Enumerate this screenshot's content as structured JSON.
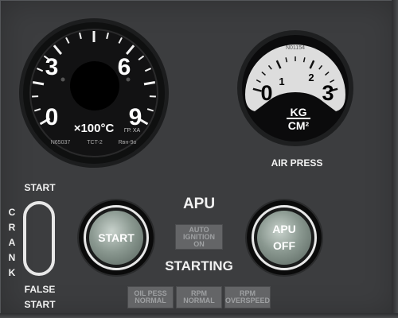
{
  "egt_gauge": {
    "scale": [
      "0",
      "3",
      "6",
      "9"
    ],
    "unit": "×100°C",
    "serial": "N65037",
    "model": "TCT-2",
    "marking_1": "ГР. ХА",
    "marking_2": "Rвн-9о"
  },
  "air_gauge": {
    "scale": [
      "0",
      "1",
      "2",
      "3"
    ],
    "serial": "N01154",
    "unit_top": "KG",
    "unit_bottom": "CM²",
    "label": "AIR PRESS"
  },
  "crank_switch": {
    "top_label": "START",
    "side_letters": [
      "C",
      "R",
      "A",
      "N",
      "K"
    ],
    "bottom_label_1": "FALSE",
    "bottom_label_2": "START"
  },
  "apu": {
    "title": "APU",
    "start_button": "START",
    "off_button_1": "APU",
    "off_button_2": "OFF",
    "starting_label": "STARTING",
    "ignition_lamp": [
      "AUTO",
      "IGNITION",
      "ON"
    ],
    "oil_lamp": [
      "OIL PESS",
      "NORMAL"
    ],
    "rpm_normal_lamp": [
      "RPM",
      "NORMAL"
    ],
    "rpm_overspeed_lamp": [
      "RPM",
      "OVERSPEED"
    ]
  },
  "colors": {
    "panel": "#3c3d3f",
    "marking": "#f2f2f2",
    "lamp_off": "#646567",
    "button_cap": "#8a9890"
  }
}
